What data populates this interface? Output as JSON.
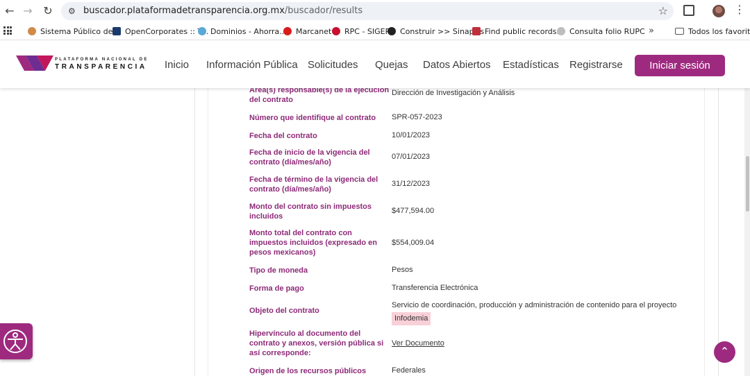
{
  "browser": {
    "url_host": "buscador.plataformadetransparencia.org.mx",
    "url_path": "/buscador/results",
    "bookmarks": [
      {
        "label": "Sistema Público de...",
        "color": "#d08a4a"
      },
      {
        "label": "OpenCorporates :: T...",
        "color": "#1a3a6b"
      },
      {
        "label": "Dominios - Ahorra...",
        "color": "#5aa9d6"
      },
      {
        "label": "Marcanet",
        "color": "#d81b1b"
      },
      {
        "label": "RPC - SIGER",
        "color": "#c8102e"
      },
      {
        "label": "Construir >> Sinapsis",
        "color": "#222222"
      },
      {
        "label": "Find public records...",
        "color": "#c0303a"
      },
      {
        "label": "Consulta folio RUPC",
        "color": "#bdbdbd"
      }
    ],
    "bookmarks_more": "»",
    "bookmarks_folder": "Todos los favoritos"
  },
  "site": {
    "logo_line1": "PLATAFORMA NACIONAL DE",
    "logo_line2": "TRANSPARENCIA",
    "nav": [
      "Inicio",
      "Información Pública",
      "Solicitudes",
      "Quejas",
      "Datos Abiertos",
      "Estadísticas",
      "Registrarse"
    ],
    "login": "Iniciar sesión",
    "accent": "#9e2a7f"
  },
  "details": [
    {
      "label": "Área(s) responsable(s) de la ejecución del contrato",
      "value": "Dirección de Investigación y Análisis"
    },
    {
      "label": "Número que identifique al contrato",
      "value": "SPR-057-2023"
    },
    {
      "label": "Fecha del contrato",
      "value": "10/01/2023"
    },
    {
      "label": "Fecha de inicio de la vigencia del contrato (día/mes/año)",
      "value": "07/01/2023"
    },
    {
      "label": "Fecha de término de la vigencia del contrato (día/mes/año)",
      "value": "31/12/2023"
    },
    {
      "label": "Monto del contrato sin impuestos incluidos",
      "value": "$477,594.00"
    },
    {
      "label": "Monto total del contrato con impuestos incluidos (expresado en pesos mexicanos)",
      "value": "$554,009.04"
    },
    {
      "label": "Tipo de moneda",
      "value": "Pesos"
    },
    {
      "label": "Forma de pago",
      "value": "Transferencia Electrónica"
    },
    {
      "label": "Objeto del contrato",
      "value": "Servicio de coordinación, producción y administración de contenido para el proyecto",
      "highlight": "Infodemia"
    },
    {
      "label": "Hipervínculo al documento del contrato y anexos, versión pública si así corresponde:",
      "value": "Ver Documento",
      "link": true
    },
    {
      "label": "Origen de los recursos públicos",
      "value": "Federales"
    }
  ]
}
